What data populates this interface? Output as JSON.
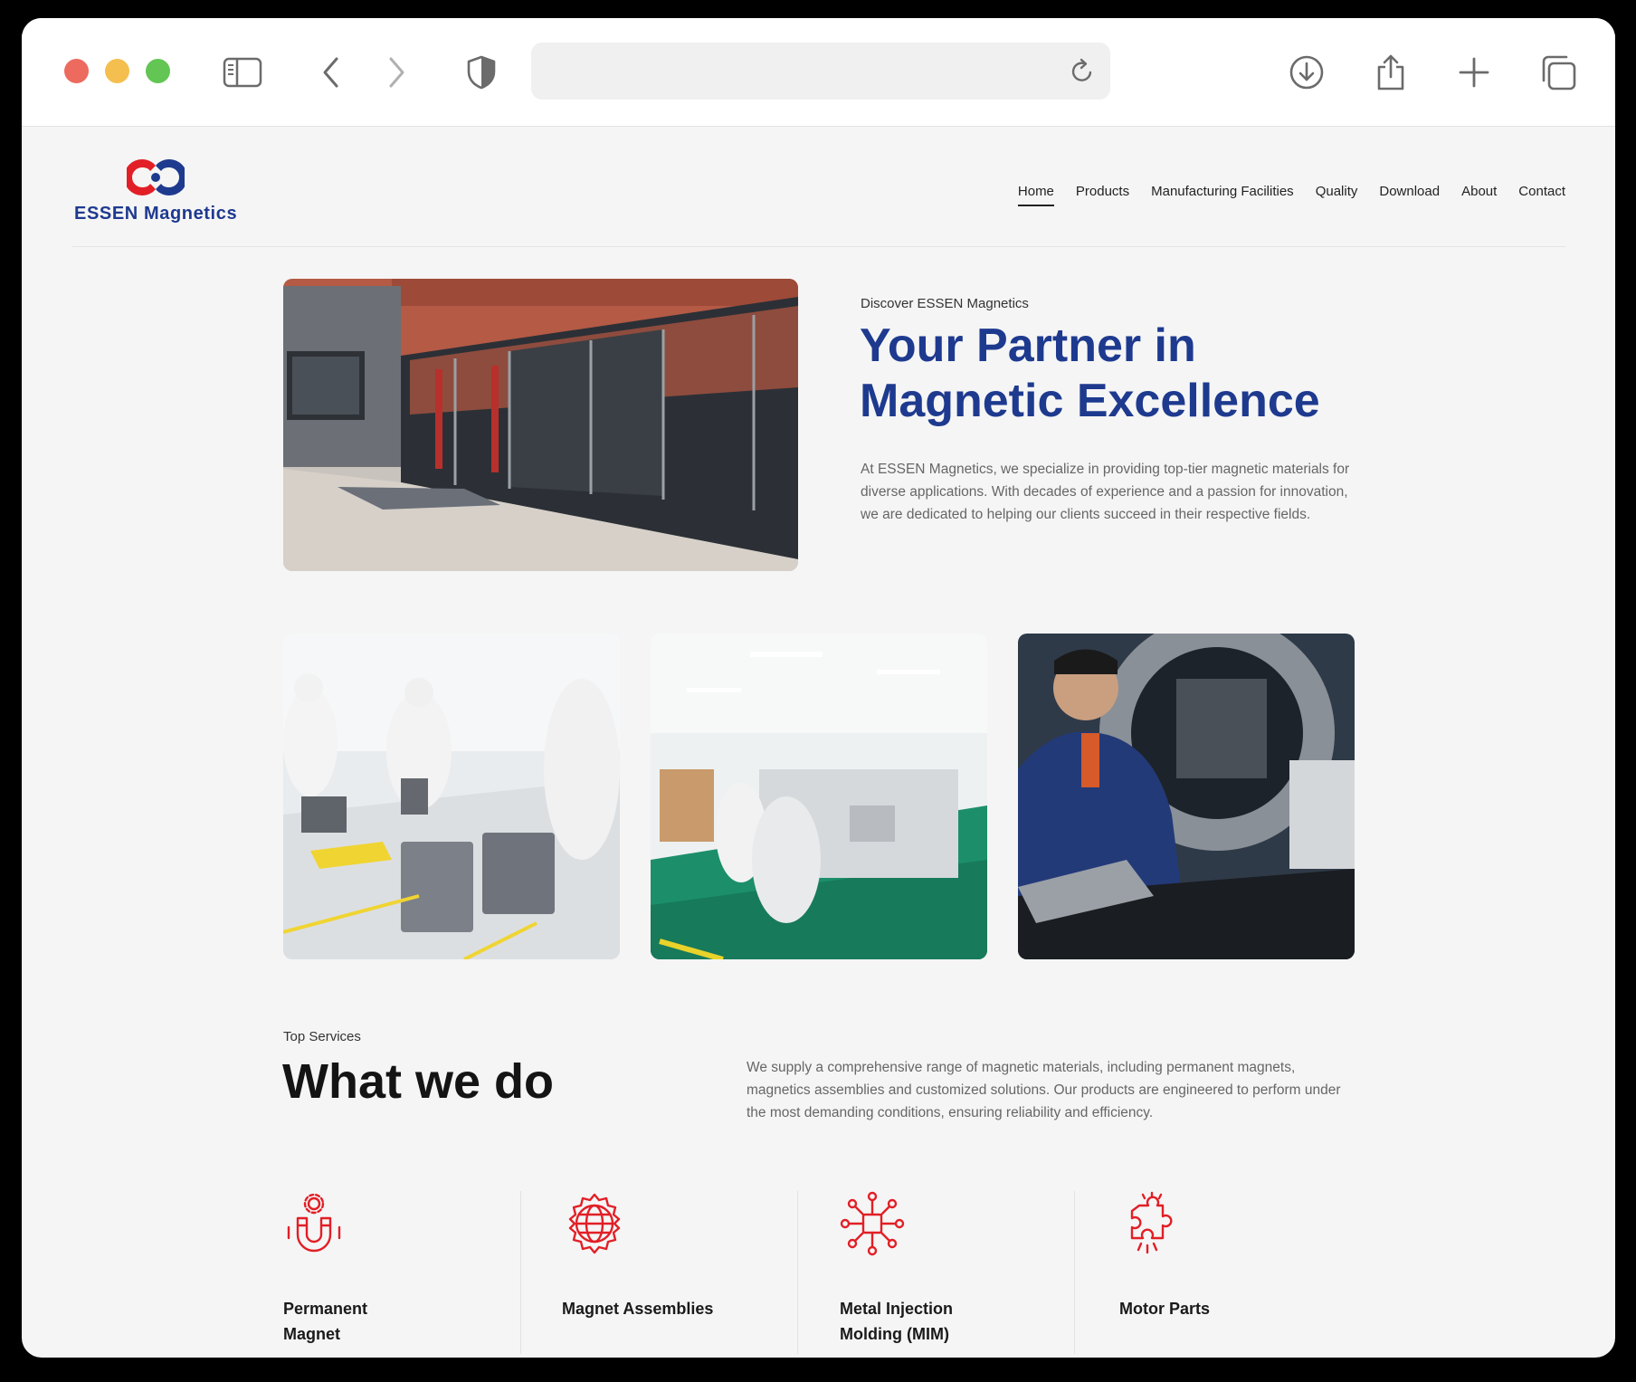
{
  "brand": {
    "name": "ESSEN Magnetics",
    "primary_color": "#1e3a8f",
    "accent_color": "#e21f26"
  },
  "browser": {
    "url": "",
    "icons": [
      "sidebar-icon",
      "back-icon",
      "forward-icon",
      "shield-icon",
      "reload-icon",
      "download-icon",
      "share-icon",
      "new-tab-icon",
      "tabs-overview-icon"
    ]
  },
  "nav": {
    "items": [
      "Home",
      "Products",
      "Manufacturing Facilities",
      "Quality",
      "Download",
      "About",
      "Contact"
    ],
    "active": "Home"
  },
  "hero": {
    "eyebrow": "Discover ESSEN Magnetics",
    "title": "Your Partner in Magnetic Excellence",
    "text": "At ESSEN Magnetics, we specialize in providing top-tier magnetic materials for diverse applications. With decades of experience and a passion for innovation, we are dedicated to helping our clients succeed in their respective fields."
  },
  "services": {
    "eyebrow": "Top Services",
    "title": "What we do",
    "text": "We supply a comprehensive range of magnetic materials, including permanent magnets, magnetics assemblies and customized solutions. Our products are engineered to perform under the most demanding conditions, ensuring reliability and efficiency.",
    "items": [
      {
        "label": "Permanent Magnet",
        "icon": "magnet-icon"
      },
      {
        "label": "Magnet Assemblies",
        "icon": "globe-gear-icon"
      },
      {
        "label": "Metal Injection Molding (MIM)",
        "icon": "network-chip-icon"
      },
      {
        "label": "Motor Parts",
        "icon": "puzzle-icon"
      }
    ]
  }
}
